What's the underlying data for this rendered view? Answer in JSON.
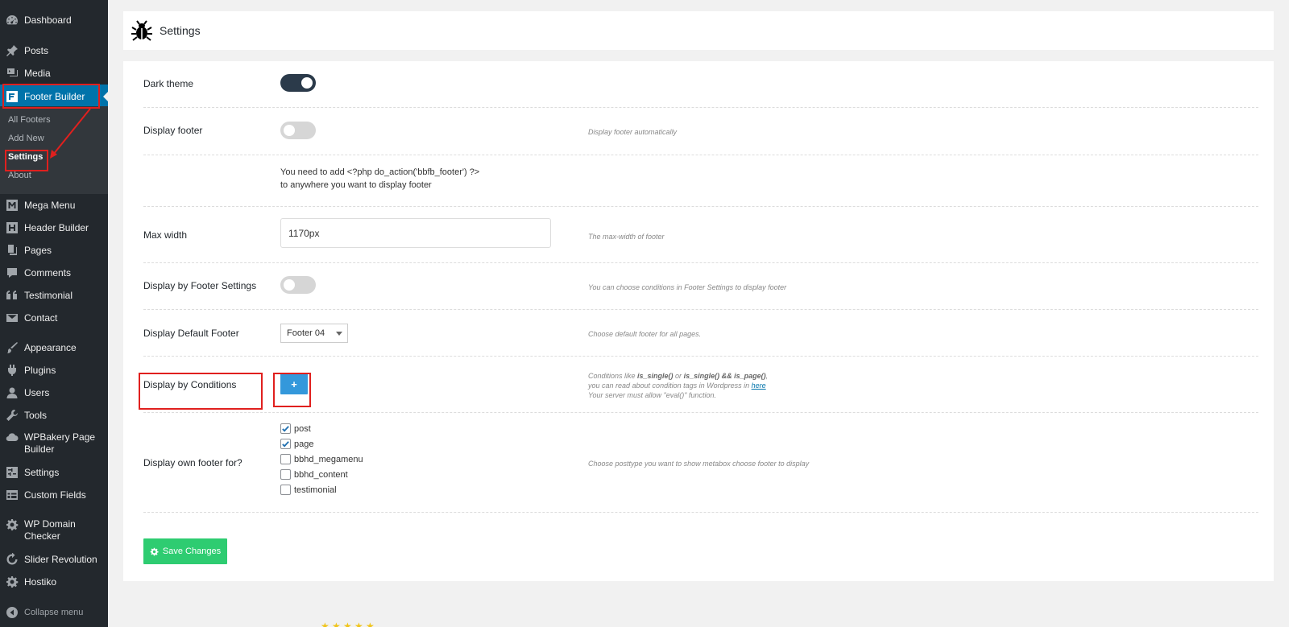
{
  "sidebar": {
    "items": [
      {
        "label": "Dashboard",
        "icon": "dashboard-icon"
      },
      {
        "label": "Posts",
        "icon": "pin-icon"
      },
      {
        "label": "Media",
        "icon": "media-icon"
      },
      {
        "label": "Footer Builder",
        "icon": "footer-builder-icon"
      },
      {
        "label": "Mega Menu",
        "icon": "mega-menu-icon"
      },
      {
        "label": "Header Builder",
        "icon": "header-builder-icon"
      },
      {
        "label": "Pages",
        "icon": "pages-icon"
      },
      {
        "label": "Comments",
        "icon": "comments-icon"
      },
      {
        "label": "Testimonial",
        "icon": "quote-icon"
      },
      {
        "label": "Contact",
        "icon": "mail-icon"
      },
      {
        "label": "Appearance",
        "icon": "brush-icon"
      },
      {
        "label": "Plugins",
        "icon": "plug-icon"
      },
      {
        "label": "Users",
        "icon": "user-icon"
      },
      {
        "label": "Tools",
        "icon": "wrench-icon"
      },
      {
        "label": "WPBakery Page Builder",
        "icon": "cloud-icon"
      },
      {
        "label": "Settings",
        "icon": "sliders-icon"
      },
      {
        "label": "Custom Fields",
        "icon": "table-icon"
      },
      {
        "label": "WP Domain Checker",
        "icon": "gear-icon"
      },
      {
        "label": "Slider Revolution",
        "icon": "refresh-icon"
      },
      {
        "label": "Hostiko",
        "icon": "gear-icon"
      },
      {
        "label": "Collapse menu",
        "icon": "collapse-icon"
      }
    ],
    "submenu": [
      {
        "label": "All Footers"
      },
      {
        "label": "Add New"
      },
      {
        "label": "Settings"
      },
      {
        "label": "About"
      }
    ]
  },
  "page": {
    "title": "Settings",
    "icon": "bug-icon"
  },
  "settings": {
    "dark_theme": {
      "label": "Dark theme",
      "enabled": true
    },
    "display_footer": {
      "label": "Display footer",
      "enabled": false,
      "desc": "Display footer automatically"
    },
    "note": {
      "line1_prefix": "You need to add ",
      "code": "<?php do_action('bbfb_footer') ?>",
      "line2": "to anywhere you want to display footer"
    },
    "max_width": {
      "label": "Max width",
      "value": "1170px",
      "desc": "The max-width of footer"
    },
    "display_by_footer_settings": {
      "label": "Display by Footer Settings",
      "enabled": false,
      "desc": "You can choose conditions in Footer Settings to display footer"
    },
    "display_default_footer": {
      "label": "Display Default Footer",
      "selected": "Footer 04",
      "desc": "Choose default footer for all pages."
    },
    "display_by_conditions": {
      "label": "Display by Conditions",
      "button": "+",
      "desc_prefix": "Conditions like ",
      "desc_code1": "is_single()",
      "desc_mid": " or ",
      "desc_code2": "is_single() && is_page()",
      "desc_suffix": ",",
      "desc_line2_prefix": "you can read about condition tags in Wordpress in ",
      "desc_link": "here",
      "desc_line3": "Your server must allow \"eval()\" function."
    },
    "own_footer": {
      "label": "Display own footer for?",
      "desc": "Choose posttype you want to show metabox choose footer to display",
      "options": [
        {
          "label": "post",
          "checked": true
        },
        {
          "label": "page",
          "checked": true
        },
        {
          "label": "bbhd_megamenu",
          "checked": false
        },
        {
          "label": "bbhd_content",
          "checked": false
        },
        {
          "label": "testimonial",
          "checked": false
        }
      ]
    },
    "save_button": "Save Changes"
  },
  "colors": {
    "sidebar_bg": "#23282d",
    "accent": "#0073aa",
    "save_green": "#2ecc71",
    "plus_blue": "#3498db",
    "highlight_red": "#e0201e"
  }
}
